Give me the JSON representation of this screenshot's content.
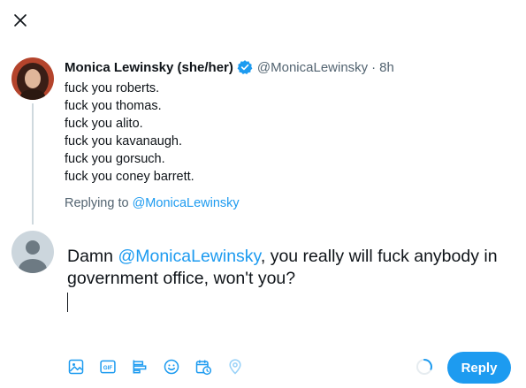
{
  "colors": {
    "accent": "#1d9bf0",
    "text": "#0f1419",
    "secondary": "#536471",
    "thread_line": "#cfd9de"
  },
  "close": {
    "icon": "close-icon"
  },
  "original_tweet": {
    "display_name": "Monica Lewinsky (she/her)",
    "verified_icon": "verified-badge-icon",
    "handle": "@MonicaLewinsky",
    "separator": "·",
    "time": "8h",
    "lines": [
      "fuck you roberts.",
      "fuck you thomas.",
      "fuck you alito.",
      "fuck you kavanaugh.",
      "fuck you gorsuch.",
      "fuck you coney barrett."
    ]
  },
  "replying_to": {
    "prefix": "Replying to",
    "handle": "@MonicaLewinsky"
  },
  "compose": {
    "text_before": "Damn ",
    "mention": "@MonicaLewinsky",
    "text_after": ", you really will fuck anybody in government office, won't you?"
  },
  "toolbar": {
    "tools": [
      {
        "name": "media-icon"
      },
      {
        "name": "gif-icon",
        "label": "GIF"
      },
      {
        "name": "poll-icon"
      },
      {
        "name": "emoji-icon"
      },
      {
        "name": "schedule-icon"
      },
      {
        "name": "location-icon",
        "disabled": true
      }
    ],
    "reply_label": "Reply"
  }
}
